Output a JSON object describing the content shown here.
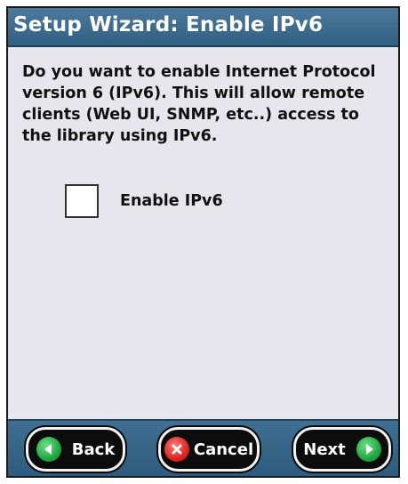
{
  "window": {
    "title": "Setup Wizard: Enable IPv6"
  },
  "main": {
    "description": "Do you want to enable Internet Protocol version 6 (IPv6). This will allow remote clients (Web UI, SNMP, etc..) access to the library using IPv6.",
    "checkbox": {
      "label": "Enable IPv6",
      "checked": false
    }
  },
  "buttons": {
    "back": {
      "label": "Back",
      "icon": "arrow-left-icon",
      "color": "#1fa83f"
    },
    "cancel": {
      "label": "Cancel",
      "icon": "x-icon",
      "color": "#e0241f"
    },
    "next": {
      "label": "Next",
      "icon": "arrow-right-icon",
      "color": "#1fa83f"
    }
  },
  "colors": {
    "title_bar": "#2f5f82",
    "content_bg": "#e6e6ec",
    "button_bar": "#3f6f92"
  }
}
